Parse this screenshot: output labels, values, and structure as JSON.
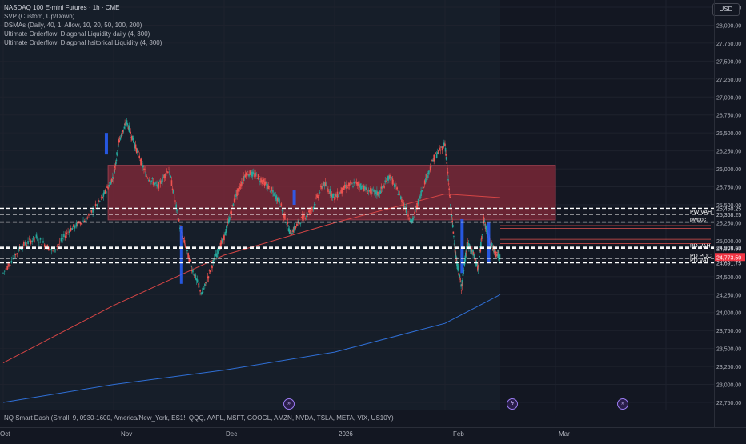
{
  "legend": {
    "title": "NASDAQ 100 E-mini Futures · 1h · CME",
    "lines": [
      "SVP (Custom, Up/Down)",
      "DSMAs (Daily, 40, 1, Allow, 10, 20, 50, 100, 200)",
      "Ultimate Orderflow: Diagonal Liquidity daily (4, 300)",
      "Ultimate Orderflow: Diagonal hsitorical Liquidity  (4, 300)"
    ]
  },
  "currency": "USD",
  "footer_indicator": "NQ Smart Dash (Small, 9, 0930-1600, America/New_York, ES1!, QQQ, AAPL, MSFT, GOOGL, AMZN, NVDA, TSLA, META, VIX, US10Y)",
  "icons": {
    "event": "lightning-icon",
    "news": "news-icon"
  },
  "colors": {
    "background": "#131722",
    "zone_fill": "#8b2a3a",
    "bull": "#26a69a",
    "bear": "#ef5350",
    "profile_blue": "#2962ff",
    "ma_red": "#d64545",
    "ma_blue": "#2f6fd6",
    "price_label": "#f23645"
  },
  "chart_data": {
    "type": "line",
    "title": "NASDAQ 100 E-mini Futures · 1h · CME",
    "x_ticks": [
      "Oct",
      "Nov",
      "Dec",
      "2026",
      "Feb",
      "Mar"
    ],
    "y_ticks": [
      "22,750.00",
      "23,000.00",
      "23,250.00",
      "23,500.00",
      "23,750.00",
      "24,000.00",
      "24,250.00",
      "24,500.00",
      "24,750.00",
      "25,000.00",
      "25,250.00",
      "25,500.00",
      "25,750.00",
      "26,000.00",
      "26,250.00",
      "26,500.00",
      "26,750.00",
      "27,000.00",
      "27,250.00",
      "27,500.00",
      "27,750.00",
      "28,000.00",
      "28,250.00"
    ],
    "ylim": [
      22650,
      28350
    ],
    "price_path_x_months": [
      0.0,
      0.15,
      0.3,
      0.45,
      0.6,
      0.75,
      0.9,
      1.0,
      1.05,
      1.12,
      1.2,
      1.3,
      1.4,
      1.5,
      1.6,
      1.7,
      1.8,
      1.9,
      2.0,
      2.1,
      2.2,
      2.3,
      2.4,
      2.5,
      2.6,
      2.7,
      2.8,
      2.9,
      3.0,
      3.1,
      3.2,
      3.3,
      3.4,
      3.5,
      3.6,
      3.7,
      3.8,
      3.9,
      4.0,
      4.05,
      4.1,
      4.15,
      4.2,
      4.25,
      4.3,
      4.35,
      4.4,
      4.45,
      4.5
    ],
    "price_path_y": [
      24550,
      24900,
      25050,
      24850,
      25150,
      25300,
      25600,
      25900,
      26400,
      26650,
      26300,
      25900,
      25750,
      26000,
      25200,
      24650,
      24250,
      24700,
      25050,
      25600,
      25950,
      25900,
      25750,
      25550,
      25100,
      25300,
      25450,
      25800,
      25600,
      25750,
      25800,
      25700,
      25650,
      25900,
      25600,
      25250,
      25750,
      26150,
      26350,
      25500,
      24750,
      24350,
      24950,
      24850,
      24600,
      25300,
      25000,
      24850,
      24773.5
    ],
    "levels": [
      {
        "value": 25450.25,
        "label": "25,450.25",
        "tag": ""
      },
      {
        "value": 25368.25,
        "label": "25,368.25",
        "tag": "PW VAH"
      },
      {
        "value": 25260,
        "label": "",
        "tag": "pwpoc"
      },
      {
        "value": 24909.5,
        "label": "24,909.50",
        "tag": ""
      },
      {
        "value": 24895.5,
        "label": "24,895.50",
        "tag": "PD VAH"
      },
      {
        "value": 24755.75,
        "label": "24,755.75",
        "tag": "PD POC"
      },
      {
        "value": 24691.75,
        "label": "24,691.75",
        "tag": "PD VAL"
      }
    ],
    "current_price": {
      "value": 24773.5,
      "label": "24,773.50"
    },
    "zone": {
      "from": 25290,
      "to": 26050,
      "x_from_months": 0.95,
      "x_to_months": 5.0
    },
    "ma_red_x": [
      0.0,
      1.0,
      2.0,
      3.0,
      4.0,
      4.5
    ],
    "ma_red_y": [
      23300,
      24100,
      24800,
      25250,
      25650,
      25600
    ],
    "ma_blue_x": [
      0.0,
      1.0,
      2.0,
      3.0,
      4.0,
      4.5
    ],
    "ma_blue_y": [
      22750,
      23000,
      23200,
      23450,
      23850,
      24250
    ]
  }
}
